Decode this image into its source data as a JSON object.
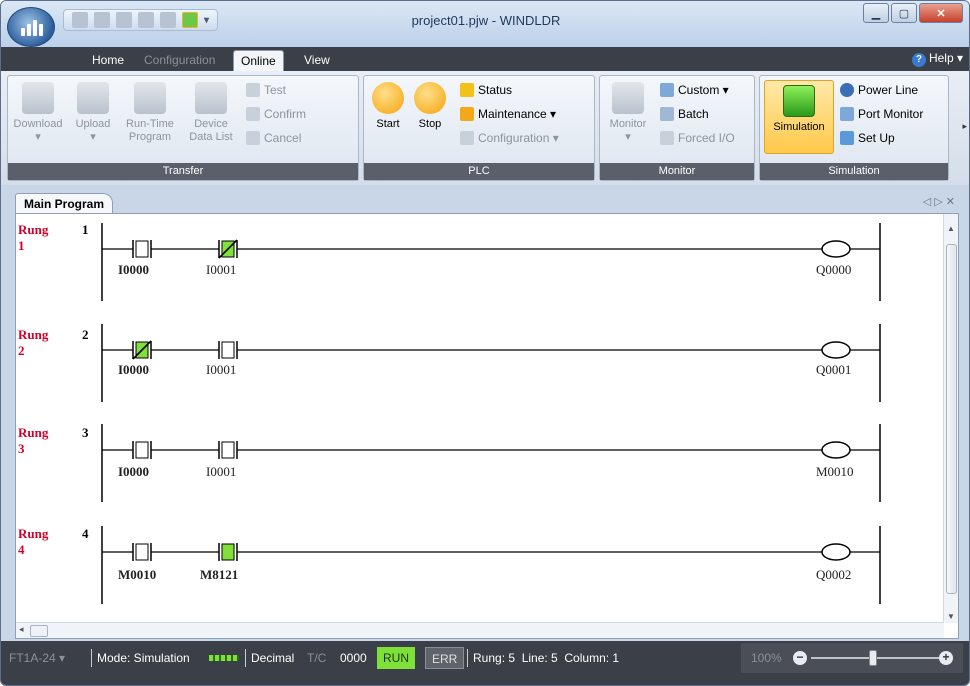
{
  "window": {
    "title": "project01.pjw - WINDLDR"
  },
  "tabs": [
    {
      "label": "Home"
    },
    {
      "label": "Configuration"
    },
    {
      "label": "Online"
    },
    {
      "label": "View"
    }
  ],
  "help": {
    "label": "Help"
  },
  "ribbon": {
    "transfer": {
      "label": "Transfer",
      "download": "Download",
      "upload": "Upload",
      "runtime_1": "Run-Time",
      "runtime_2": "Program",
      "device_1": "Device",
      "device_2": "Data List",
      "test": "Test",
      "confirm": "Confirm",
      "cancel": "Cancel"
    },
    "plc": {
      "label": "PLC",
      "start": "Start",
      "stop": "Stop",
      "status": "Status",
      "maintenance": "Maintenance",
      "configuration": "Configuration"
    },
    "monitor": {
      "label": "Monitor",
      "monitor": "Monitor",
      "custom": "Custom",
      "batch": "Batch",
      "forced_io": "Forced I/O"
    },
    "simulation": {
      "label": "Simulation",
      "simulation": "Simulation",
      "power_line": "Power Line",
      "port_monitor": "Port Monitor",
      "set_up": "Set Up"
    }
  },
  "document": {
    "tab": "Main Program"
  },
  "rungs": [
    {
      "label": "Rung",
      "num": "1",
      "number": "1",
      "contacts": [
        {
          "operand": "I0000",
          "state": "off"
        },
        {
          "operand": "I0001",
          "state": "on"
        }
      ],
      "coil": "Q0000"
    },
    {
      "label": "Rung",
      "num": "2",
      "number": "2",
      "contacts": [
        {
          "operand": "I0000",
          "state": "on"
        },
        {
          "operand": "I0001",
          "state": "off"
        }
      ],
      "coil": "Q0001"
    },
    {
      "label": "Rung",
      "num": "3",
      "number": "3",
      "contacts": [
        {
          "operand": "I0000",
          "state": "off"
        },
        {
          "operand": "I0001",
          "state": "off"
        }
      ],
      "coil": "M0010"
    },
    {
      "label": "Rung",
      "num": "4",
      "number": "4",
      "contacts": [
        {
          "operand": "M0010",
          "state": "off"
        },
        {
          "operand": "M8121",
          "state": "on"
        }
      ],
      "coil": "Q0002"
    }
  ],
  "status": {
    "plc_type": "FT1A-24",
    "mode": "Mode: Simulation",
    "format": "Decimal",
    "tc": "T/C",
    "tc_value": "0000",
    "run": "RUN",
    "err": "ERR",
    "position": "Rung: 5  Line: 5  Column: 1",
    "zoom": "100%"
  },
  "colors": {
    "accent_green": "#7fe03a",
    "rung_label": "#d4002a",
    "chrome_dark": "#3b3f47"
  }
}
